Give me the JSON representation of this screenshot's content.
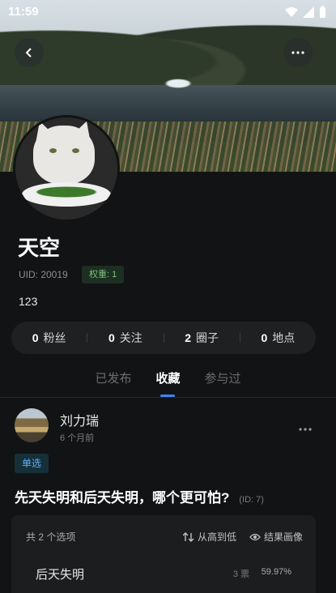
{
  "status": {
    "time": "11:59"
  },
  "profile": {
    "name": "天空",
    "uid": "UID: 20019",
    "badge": "权重: 1",
    "bio": "123"
  },
  "stats": [
    {
      "count": "0",
      "label": "粉丝"
    },
    {
      "count": "0",
      "label": "关注"
    },
    {
      "count": "2",
      "label": "圈子"
    },
    {
      "count": "0",
      "label": "地点"
    }
  ],
  "tabs": [
    "已发布",
    "收藏",
    "参与过"
  ],
  "post": {
    "author": "刘力瑞",
    "time": "6 个月前",
    "tag": "单选",
    "question": "先天失明和后天失明，哪个更可怕?",
    "qid": "(ID: 7)",
    "options_count": "共 2 个选项",
    "sort_label": "从高到低",
    "portrait_label": "结果画像",
    "option": {
      "label": "后天失明",
      "votes": "3 票",
      "percent": "59.97%"
    }
  },
  "colors": {
    "accent": "#3a86ff",
    "badge_green": "#7fc27a",
    "tag_blue": "#64aef0"
  }
}
